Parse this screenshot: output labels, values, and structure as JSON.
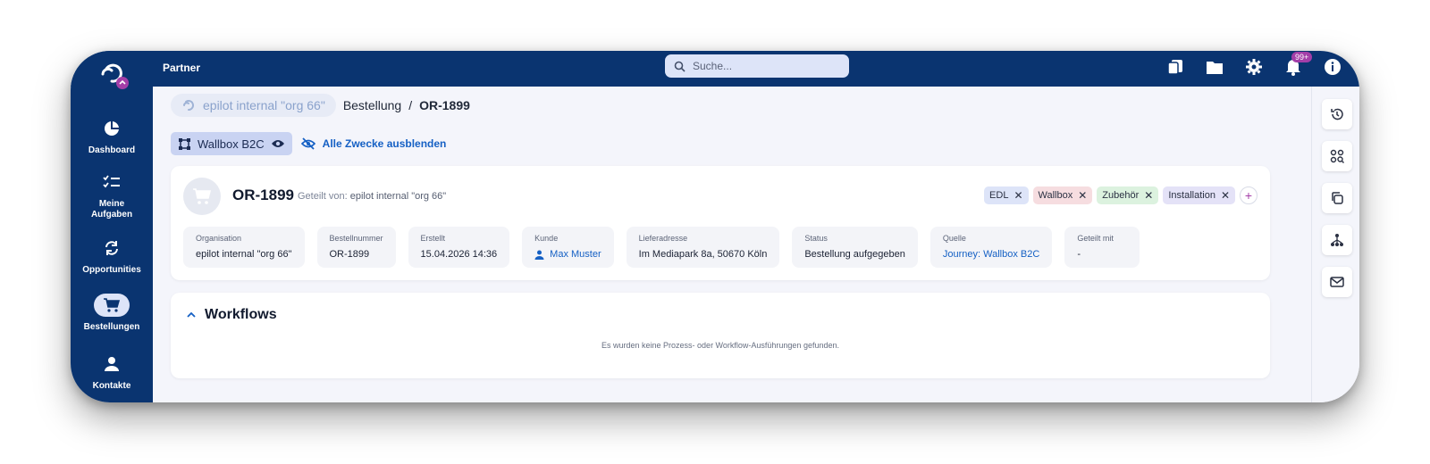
{
  "header": {
    "org_label": "Partner",
    "search_placeholder": "Suche...",
    "notification_badge": "99+"
  },
  "sidebar": {
    "items": [
      {
        "label": "Dashboard"
      },
      {
        "label": "Meine Aufgaben"
      },
      {
        "label": "Opportunities"
      },
      {
        "label": "Bestellungen"
      },
      {
        "label": "Kontakte"
      }
    ]
  },
  "breadcrumb": {
    "org": "epilot internal \"org 66\"",
    "section": "Bestellung",
    "separator": "/",
    "current": "OR-1899"
  },
  "purposes": {
    "chip_label": "Wallbox B2C",
    "hide_all": "Alle Zwecke ausblenden"
  },
  "order": {
    "title": "OR-1899",
    "shared_by_label": "Geteilt von:",
    "shared_by_org": "epilot internal \"org 66\"",
    "tags": [
      {
        "label": "EDL",
        "color": "#dde4f8"
      },
      {
        "label": "Wallbox",
        "color": "#f6dde0"
      },
      {
        "label": "Zubehör",
        "color": "#dcf2df"
      },
      {
        "label": "Installation",
        "color": "#e4e2f7"
      }
    ],
    "add_tag": "+",
    "fields": [
      {
        "label": "Organisation",
        "value": "epilot internal \"org 66\""
      },
      {
        "label": "Bestellnummer",
        "value": "OR-1899"
      },
      {
        "label": "Erstellt",
        "value": "15.04.2026 14:36"
      },
      {
        "label": "Kunde",
        "value": "Max Muster"
      },
      {
        "label": "Lieferadresse",
        "value": "Im Mediapark 8a, 50670 Köln"
      },
      {
        "label": "Status",
        "value": "Bestellung aufgegeben"
      },
      {
        "label": "Quelle",
        "value": "Journey: Wallbox B2C"
      },
      {
        "label": "Geteilt mit",
        "value": "-"
      }
    ]
  },
  "workflows": {
    "title": "Workflows",
    "empty_text": "Es wurden keine Prozess- oder Workflow-Ausführungen gefunden."
  },
  "colors": {
    "navy": "#0a3470",
    "accent_link": "#1560c4",
    "badge": "#a33ea8"
  }
}
